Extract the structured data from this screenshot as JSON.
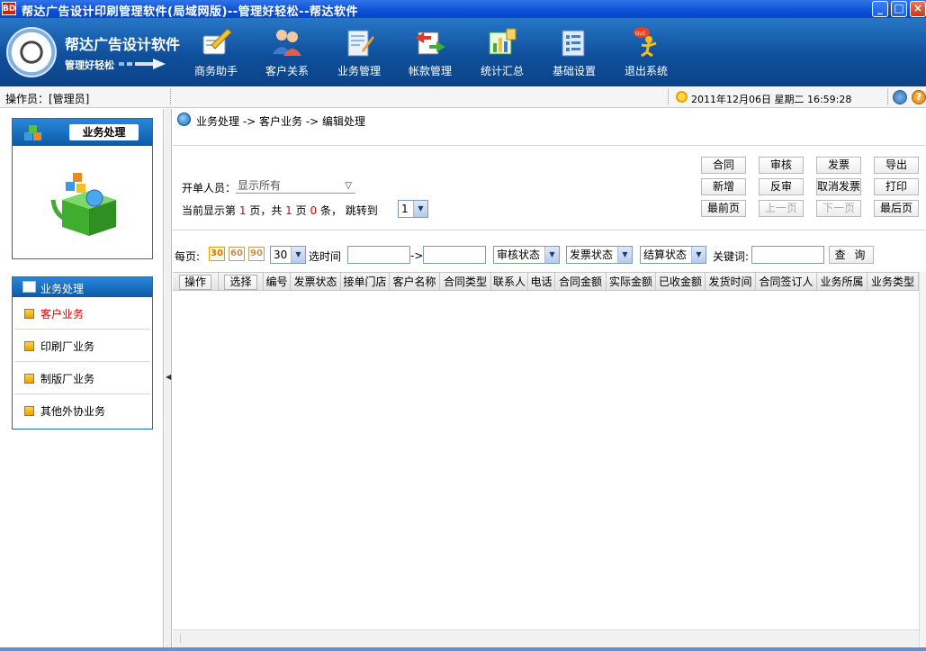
{
  "window": {
    "title": "帮达广告设计印刷管理软件(局域网版)--管理好轻松--帮达软件",
    "app_icon_text": "BD"
  },
  "brand": {
    "name": "帮达广告设计软件",
    "slogan": "管理好轻松"
  },
  "nav": [
    {
      "label": "商务助手",
      "icon": "pen-notebook-icon",
      "color": "#f0c040"
    },
    {
      "label": "客户关系",
      "icon": "people-icon",
      "color": "#e06050"
    },
    {
      "label": "业务管理",
      "icon": "document-pen-icon",
      "color": "#8fb6e0"
    },
    {
      "label": "帐款管理",
      "icon": "transfer-icon",
      "color": "#d93c2a"
    },
    {
      "label": "统计汇总",
      "icon": "chart-icon",
      "color": "#3cae3c"
    },
    {
      "label": "基础设置",
      "icon": "settings-book-icon",
      "color": "#3f7fd0"
    },
    {
      "label": "退出系统",
      "icon": "exit-runner-icon",
      "color": "#e84020"
    }
  ],
  "status": {
    "operator": "操作员：[管理员]",
    "datetime": "2011年12月06日  星期二  16:59:28"
  },
  "sidebar": {
    "panel_title": "业务处理",
    "section_title": "业务处理",
    "items": [
      {
        "label": "客户业务",
        "active": true
      },
      {
        "label": "印刷厂业务",
        "active": false
      },
      {
        "label": "制版厂业务",
        "active": false
      },
      {
        "label": "其他外协业务",
        "active": false
      }
    ]
  },
  "breadcrumb": "业务处理 -> 客户业务 -> 编辑处理",
  "filters": {
    "creator_label": "开单人员：",
    "creator_value": "显示所有",
    "page_info": {
      "prefix": "当前显示第",
      "current_page": "1",
      "mid1": "页，共",
      "total_pages": "1",
      "mid2": "页",
      "count": "0",
      "suffix": "条， 跳转到"
    },
    "jump_value": "1"
  },
  "actions": [
    {
      "label": "合同",
      "enabled": true
    },
    {
      "label": "审核",
      "enabled": true
    },
    {
      "label": "发票",
      "enabled": true
    },
    {
      "label": "导出",
      "enabled": true
    },
    {
      "label": "新增",
      "enabled": true
    },
    {
      "label": "反审",
      "enabled": true
    },
    {
      "label": "取消发票",
      "enabled": true
    },
    {
      "label": "打印",
      "enabled": true
    },
    {
      "label": "最前页",
      "enabled": true
    },
    {
      "label": "上一页",
      "enabled": false
    },
    {
      "label": "下一页",
      "enabled": false
    },
    {
      "label": "最后页",
      "enabled": true
    }
  ],
  "search": {
    "per_page_label": "每页:",
    "page_sizes": [
      "30",
      "60",
      "90"
    ],
    "page_size_value": "30",
    "time_label": "选时间",
    "range_arrow": "->",
    "audit_status": "审核状态",
    "invoice_status": "发票状态",
    "settle_status": "结算状态",
    "keyword_label": "关键词:",
    "keyword_value": "",
    "query_button": "查 询"
  },
  "grid": {
    "columns": [
      "操作",
      "选择",
      "编号",
      "发票状态",
      "接单门店",
      "客户名称",
      "合同类型",
      "联系人",
      "电话",
      "合同金额",
      "实际金额",
      "已收金额",
      "发货时间",
      "合同签订人",
      "业务所属",
      "业务类型"
    ],
    "rows": []
  }
}
